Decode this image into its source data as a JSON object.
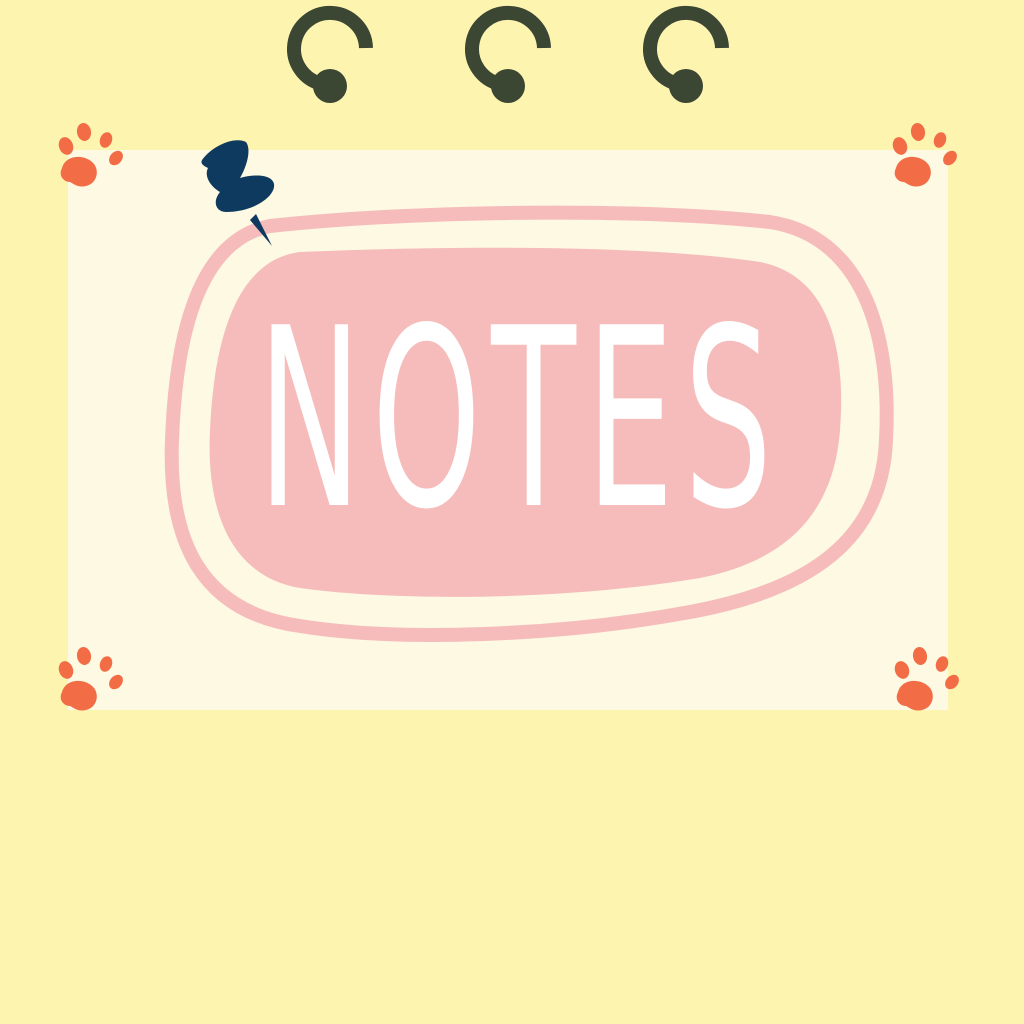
{
  "title": "NOTES",
  "colors": {
    "background": "#fdf4b0",
    "card": "#fdf9e3",
    "blob": "#f6bcbb",
    "title_text": "#ffffff",
    "paw": "#f26c46",
    "rings": "#3b4633",
    "pin": "#0f3a5f"
  },
  "icons": [
    "binder-ring-icon",
    "push-pin-icon",
    "paw-print-icon"
  ]
}
